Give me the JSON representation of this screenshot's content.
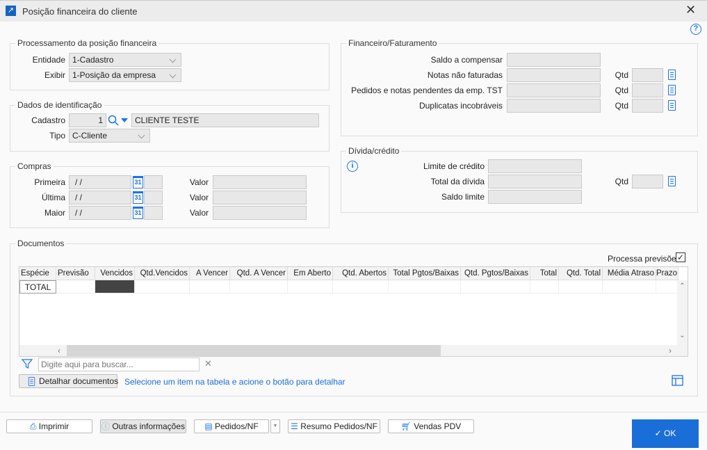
{
  "window": {
    "title": "Posição financeira do cliente",
    "close": "✕",
    "help": "?"
  },
  "processamento": {
    "legend": "Processamento da posição financeira",
    "entidade_label": "Entidade",
    "entidade_value": "1-Cadastro",
    "exibir_label": "Exibir",
    "exibir_value": "1-Posição da empresa"
  },
  "identificacao": {
    "legend": "Dados de identificação",
    "cadastro_label": "Cadastro",
    "cadastro_value": "1",
    "nome_value": "CLIENTE TESTE",
    "tipo_label": "Tipo",
    "tipo_value": "C-Cliente"
  },
  "compras": {
    "legend": "Compras",
    "rows": [
      {
        "label": "Primeira",
        "date": " /  /",
        "valor_label": "Valor",
        "valor": ""
      },
      {
        "label": "Última",
        "date": " /  /",
        "valor_label": "Valor",
        "valor": ""
      },
      {
        "label": "Maior",
        "date": " /  /",
        "valor_label": "Valor",
        "valor": ""
      }
    ],
    "calendar_glyph": "31"
  },
  "financeiro": {
    "legend": "Financeiro/Faturamento",
    "rows": [
      {
        "label": "Saldo a compensar",
        "value": ""
      },
      {
        "label": "Notas não faturadas",
        "value": "",
        "qtd_label": "Qtd",
        "qtd": ""
      },
      {
        "label": "Pedidos e notas pendentes da emp. TST",
        "value": "",
        "qtd_label": "Qtd",
        "qtd": ""
      },
      {
        "label": "Duplicatas incobráveis",
        "value": "",
        "qtd_label": "Qtd",
        "qtd": ""
      }
    ]
  },
  "divida": {
    "legend": "Dívida/crédito",
    "info": "i",
    "rows": [
      {
        "label": "Limite de crédito",
        "value": ""
      },
      {
        "label": "Total da dívida",
        "value": "",
        "qtd_label": "Qtd",
        "qtd": ""
      },
      {
        "label": "Saldo limite",
        "value": ""
      }
    ]
  },
  "documentos": {
    "legend": "Documentos",
    "processa_label": "Processa previsões",
    "processa_checked": true,
    "columns": [
      "Espécie",
      "Previsão",
      "Vencidos",
      "Qtd.Vencidos",
      "A Vencer",
      "Qtd. A Vencer",
      "Em Aberto",
      "Qtd. Abertos",
      "Total Pgtos/Baixas",
      "Qtd. Pgtos/Baixas",
      "Total",
      "Qtd. Total",
      "Média Atraso",
      "Prazo"
    ],
    "rows": [
      [
        "TOTAL",
        "",
        "",
        "",
        "",
        "",
        "",
        "",
        "",
        "",
        "",
        "",
        "",
        ""
      ]
    ],
    "search_placeholder": "Digite aqui para buscar...",
    "detalhar_label": "Detalhar documentos",
    "hint": "Selecione um item na tabela e acione o botão para detalhar"
  },
  "footer": {
    "imprimir": "Imprimir",
    "outras": "Outras informações",
    "pedidos": "Pedidos/NF",
    "resumo": "Resumo Pedidos/NF",
    "vendas": "Vendas PDV",
    "ok": "OK"
  },
  "colors": {
    "accent": "#1a73e8",
    "ok_button": "#1a6ed8"
  }
}
